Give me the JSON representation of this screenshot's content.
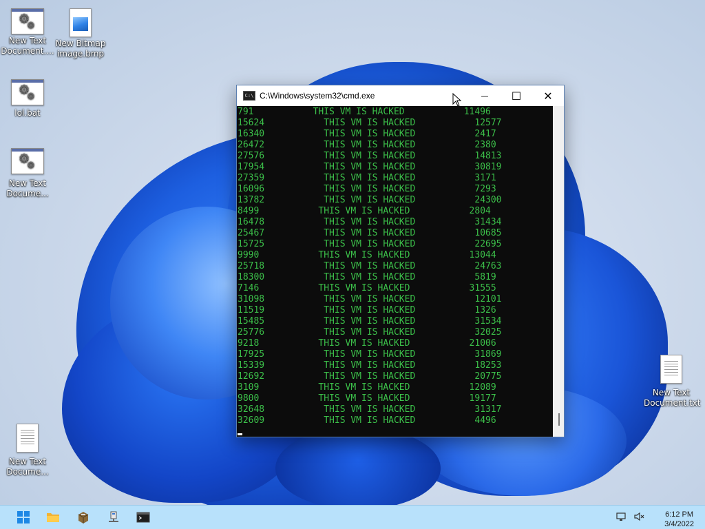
{
  "desktop": {
    "icons": [
      {
        "label_line1": "New Text",
        "label_line2": "Document....",
        "type": "batch-file-icon"
      },
      {
        "label_line1": "New Bitmap",
        "label_line2": "image.bmp",
        "type": "bitmap-file-icon"
      },
      {
        "label_line1": "lol.bat",
        "label_line2": "",
        "type": "batch-file-icon"
      },
      {
        "label_line1": "New Text",
        "label_line2": "Docume...",
        "type": "batch-file-icon"
      },
      {
        "label_line1": "New Text",
        "label_line2": "Document.txt",
        "type": "text-file-icon"
      },
      {
        "label_line1": "New Text",
        "label_line2": "Docume...",
        "type": "text-file-icon"
      }
    ]
  },
  "cmd_window": {
    "title": "C:\\Windows\\system32\\cmd.exe",
    "icon_text": "C:\\",
    "minimize": "—",
    "maximize": "☐",
    "close": "✕",
    "text_color": "#3cc04a",
    "lines": [
      "791           THIS VM IS HACKED           11496",
      "15624           THIS VM IS HACKED           12577",
      "16340           THIS VM IS HACKED           2417",
      "26472           THIS VM IS HACKED           2380",
      "27576           THIS VM IS HACKED           14813",
      "17954           THIS VM IS HACKED           30819",
      "27359           THIS VM IS HACKED           3171",
      "16096           THIS VM IS HACKED           7293",
      "13782           THIS VM IS HACKED           24300",
      "8499           THIS VM IS HACKED           2804",
      "16478           THIS VM IS HACKED           31434",
      "25467           THIS VM IS HACKED           10685",
      "15725           THIS VM IS HACKED           22695",
      "9990           THIS VM IS HACKED           13044",
      "25718           THIS VM IS HACKED           24763",
      "18300           THIS VM IS HACKED           5819",
      "7146           THIS VM IS HACKED           31555",
      "31098           THIS VM IS HACKED           12101",
      "11519           THIS VM IS HACKED           1326",
      "15485           THIS VM IS HACKED           31534",
      "25776           THIS VM IS HACKED           32025",
      "9218           THIS VM IS HACKED           21006",
      "17925           THIS VM IS HACKED           31869",
      "15339           THIS VM IS HACKED           18253",
      "12692           THIS VM IS HACKED           20775",
      "3109           THIS VM IS HACKED           12089",
      "9800           THIS VM IS HACKED           19177",
      "32648           THIS VM IS HACKED           31317",
      "32609           THIS VM IS HACKED           4496"
    ]
  },
  "taskbar": {
    "color": "#b8e1fb",
    "time": "6:12 PM",
    "date": "3/4/2022"
  }
}
